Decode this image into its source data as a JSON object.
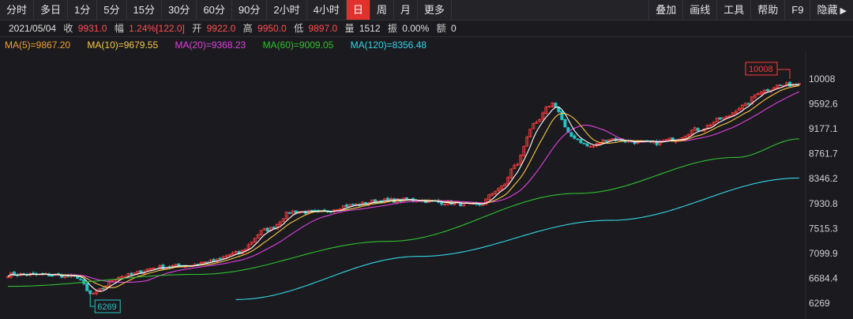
{
  "toolbar": {
    "tabs": [
      "分时",
      "多日",
      "1分",
      "5分",
      "15分",
      "30分",
      "60分",
      "90分",
      "2小时",
      "4小时",
      "日",
      "周",
      "月",
      "更多"
    ],
    "active": "日",
    "tools": [
      "叠加",
      "画线",
      "工具",
      "帮助",
      "F9",
      "隐藏"
    ],
    "hide_icon": "triangle-right-icon"
  },
  "info": {
    "date": "2021/05/04",
    "close_label": "收",
    "close": "9931.0",
    "change_label": "幅",
    "change": "1.24%[122.0]",
    "open_label": "开",
    "open": "9922.0",
    "high_label": "高",
    "high": "9950.0",
    "low_label": "低",
    "low": "9897.0",
    "volume_label": "量",
    "volume": "1512",
    "amplitude_label": "振",
    "amplitude": "0.00%",
    "amount_label": "额",
    "amount": "0"
  },
  "ma": {
    "ma5": "MA(5)=9867.20",
    "ma10": "MA(10)=9679.55",
    "ma20": "MA(20)=9368.23",
    "ma60": "MA(60)=9009.05",
    "ma120": "MA(120)=8356.48"
  },
  "colors": {
    "up": "#ff3b3b",
    "down": "#22c3c3",
    "ma5": "#ffffff",
    "ma10": "#f6c744",
    "ma20": "#e040e0",
    "ma60": "#2fc02f",
    "ma120": "#33d6e6"
  },
  "chart_data": {
    "type": "candlestick",
    "y_ticks": [
      "10008",
      "9592.6",
      "9177.1",
      "8761.7",
      "8346.2",
      "7930.8",
      "7515.3",
      "7099.9",
      "6684.4",
      "6269"
    ],
    "ylim": [
      6269,
      10008
    ],
    "annotations": {
      "max_label": "10008",
      "min_label": "6269"
    },
    "anchors": {
      "index": [
        0,
        14,
        22,
        26,
        36,
        48,
        56,
        64,
        72,
        82,
        90,
        98,
        108,
        118,
        128,
        138,
        148,
        156,
        160,
        166,
        172,
        178,
        184,
        190,
        198,
        204,
        210,
        218,
        226,
        232,
        238,
        244,
        250
      ],
      "price": [
        6750,
        6740,
        6710,
        6420,
        6720,
        6870,
        6900,
        6960,
        7100,
        7500,
        7800,
        7780,
        7900,
        7980,
        7990,
        7950,
        7900,
        8200,
        8550,
        9230,
        9600,
        9050,
        8880,
        9010,
        8960,
        8940,
        9000,
        9170,
        9350,
        9550,
        9810,
        9900,
        9931
      ]
    },
    "ma60_anchors": {
      "index": [
        0,
        60,
        120,
        180,
        230,
        250
      ],
      "price": [
        6550,
        6750,
        7300,
        8100,
        8700,
        9009
      ]
    },
    "ma120_anchors": {
      "index": [
        72,
        130,
        190,
        250
      ],
      "price": [
        6330,
        7050,
        7650,
        8356
      ]
    }
  }
}
